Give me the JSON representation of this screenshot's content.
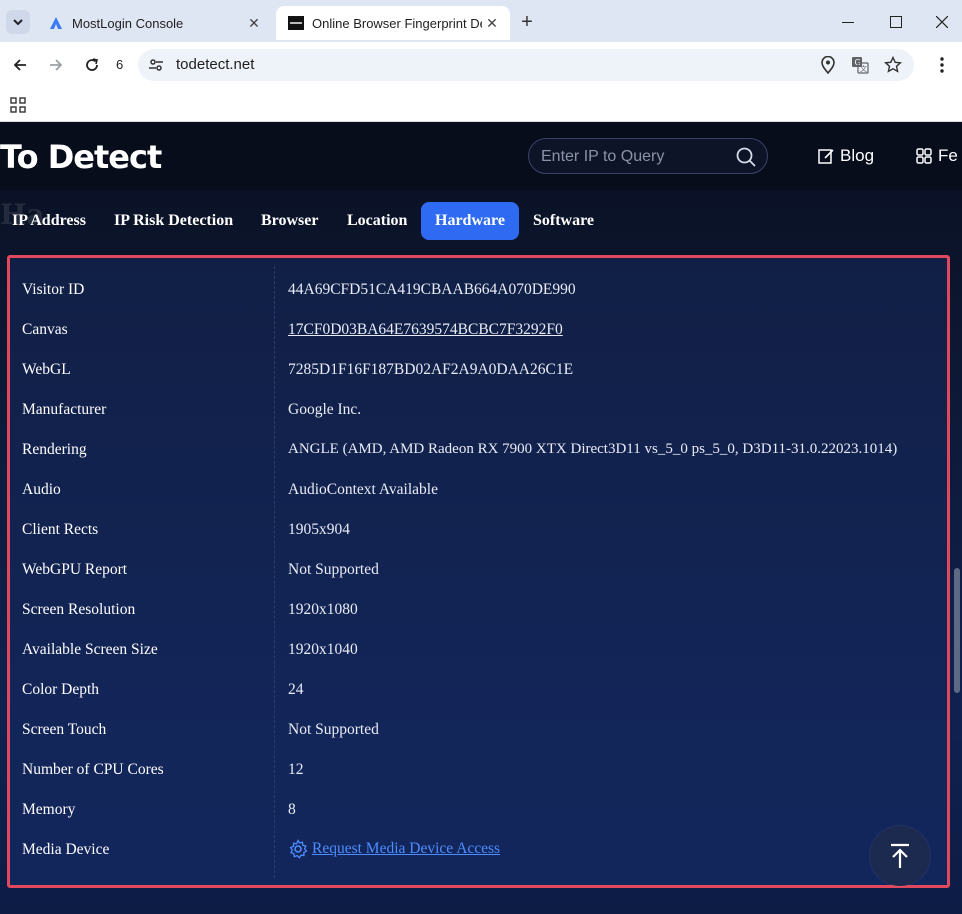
{
  "browser": {
    "tabs": [
      {
        "title": "MostLogin Console",
        "active": false
      },
      {
        "title": "Online Browser Fingerprint De",
        "active": true
      }
    ],
    "toolbar": {
      "count_badge": "6",
      "url": "todetect.net"
    }
  },
  "site": {
    "logo_text": "To Detect",
    "search": {
      "placeholder": "Enter IP to Query"
    },
    "header_links": {
      "blog": "Blog",
      "second": "Fe"
    },
    "ghost_heading": "Ha",
    "nav_tabs": [
      "IP Address",
      "IP Risk Detection",
      "Browser",
      "Location",
      "Hardware",
      "Software"
    ],
    "active_tab": "Hardware"
  },
  "hardware": {
    "rows": [
      {
        "label": "Visitor ID",
        "value": "44A69CFD51CA419CBAAB664A070DE990"
      },
      {
        "label": "Canvas",
        "value": "17CF0D03BA64E7639574BCBC7F3292F0"
      },
      {
        "label": "WebGL",
        "value": "7285D1F16F187BD02AF2A9A0DAA26C1E"
      },
      {
        "label": "Manufacturer",
        "value": "Google Inc."
      },
      {
        "label": "Rendering",
        "value": "ANGLE (AMD, AMD Radeon RX 7900 XTX Direct3D11 vs_5_0 ps_5_0, D3D11-31.0.22023.1014)"
      },
      {
        "label": "Audio",
        "value": "AudioContext Available"
      },
      {
        "label": "Client Rects",
        "value": "1905x904"
      },
      {
        "label": "WebGPU Report",
        "value": "Not Supported"
      },
      {
        "label": "Screen Resolution",
        "value": "1920x1080"
      },
      {
        "label": "Available Screen Size",
        "value": "1920x1040"
      },
      {
        "label": "Color Depth",
        "value": "24"
      },
      {
        "label": "Screen Touch",
        "value": "Not Supported"
      },
      {
        "label": "Number of CPU Cores",
        "value": "12"
      },
      {
        "label": "Memory",
        "value": "8"
      },
      {
        "label": "Media Device",
        "value": "Request Media Device Access"
      }
    ]
  },
  "colors": {
    "accent": "#2f6bf2",
    "highlight_border": "#e0495c",
    "link": "#4c8dff"
  }
}
